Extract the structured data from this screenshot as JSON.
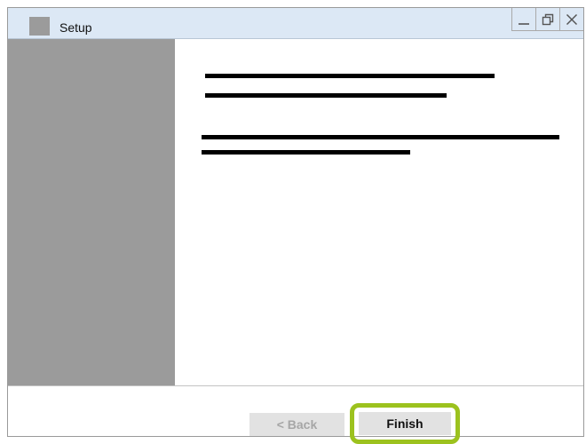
{
  "window": {
    "title": "Setup"
  },
  "footer": {
    "back_label": "< Back",
    "finish_label": "Finish"
  },
  "colors": {
    "titlebar": "#dce8f5",
    "sidebar": "#9b9b9b",
    "highlight": "#9cc21e",
    "button": "#e2e2e2",
    "disabled_text": "#a6a6a6"
  },
  "icons": {
    "app": "app-icon",
    "minimize": "minimize-icon",
    "restore": "restore-icon",
    "close": "close-icon"
  }
}
